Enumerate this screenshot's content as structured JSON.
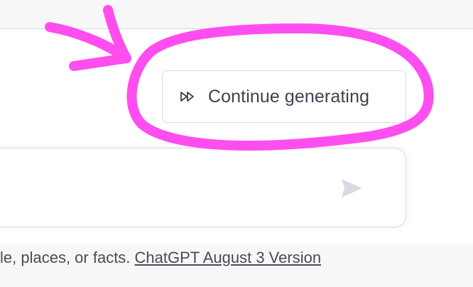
{
  "main": {
    "continue_button": {
      "label": "Continue generating",
      "icon": "fast-forward-icon"
    }
  },
  "composer": {
    "placeholder": "",
    "send_icon": "send-arrow-icon"
  },
  "footer": {
    "disclaimer_text": "le, places, or facts. ",
    "version_link": "ChatGPT August 3 Version"
  },
  "annotation": {
    "color": "#ff44ee",
    "shapes": [
      "arrow",
      "circle"
    ]
  }
}
